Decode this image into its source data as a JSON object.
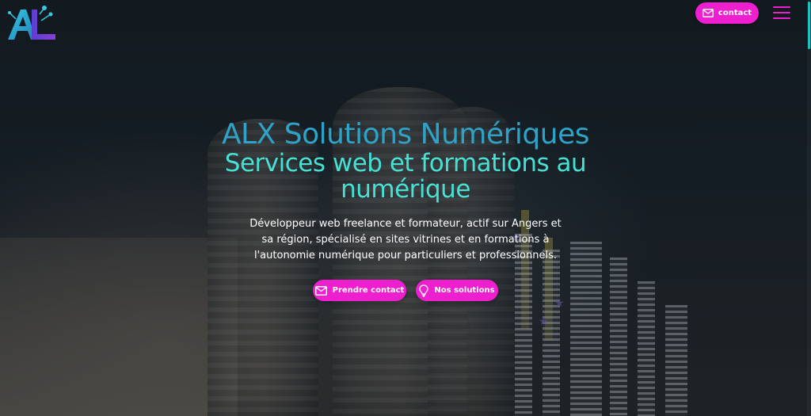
{
  "header": {
    "logo_text": "AL",
    "contact_label": "contact",
    "contact_icon": "envelope-icon",
    "menu_icon": "hamburger-menu-icon"
  },
  "hero": {
    "title": "ALX Solutions Numériques",
    "subtitle": "Services web et formations au numérique",
    "description": "Développeur web freelance et formateur, actif sur Angers et sa région, spécialisé en sites vitrines et en formations à l'autonomie numérique pour particuliers et professionnels.",
    "buttons": [
      {
        "label": "Prendre contact",
        "icon": "envelope-icon"
      },
      {
        "label": "Nos solutions",
        "icon": "lightbulb-icon"
      }
    ]
  },
  "colors": {
    "accent": "#ee1fcf",
    "title": "#2fa3c7",
    "subtitle": "#47e0d4",
    "scrollbar": "#18c3c4"
  }
}
